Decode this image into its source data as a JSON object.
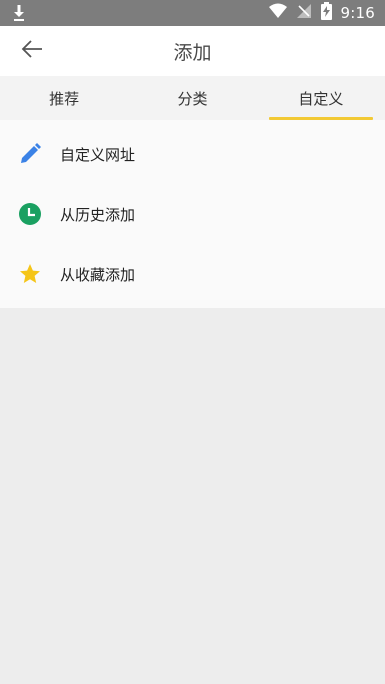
{
  "status_bar": {
    "time": "9:16",
    "icons": [
      "download-icon",
      "wifi-icon",
      "signal-icon",
      "battery-charging-icon"
    ]
  },
  "app_bar": {
    "back_icon": "arrow-left-icon",
    "title": "添加"
  },
  "tabs": [
    {
      "label": "推荐",
      "active": false
    },
    {
      "label": "分类",
      "active": false
    },
    {
      "label": "自定义",
      "active": true
    }
  ],
  "items": [
    {
      "label": "自定义网址",
      "icon": "pencil-icon",
      "color": "#3b82e6"
    },
    {
      "label": "从历史添加",
      "icon": "clock-icon",
      "color": "#1aa061"
    },
    {
      "label": "从收藏添加",
      "icon": "star-icon",
      "color": "#f5c518"
    }
  ],
  "colors": {
    "status_bar": "#7d7d7d",
    "tab_indicator": "#f2c934",
    "page_background": "#ededed"
  }
}
